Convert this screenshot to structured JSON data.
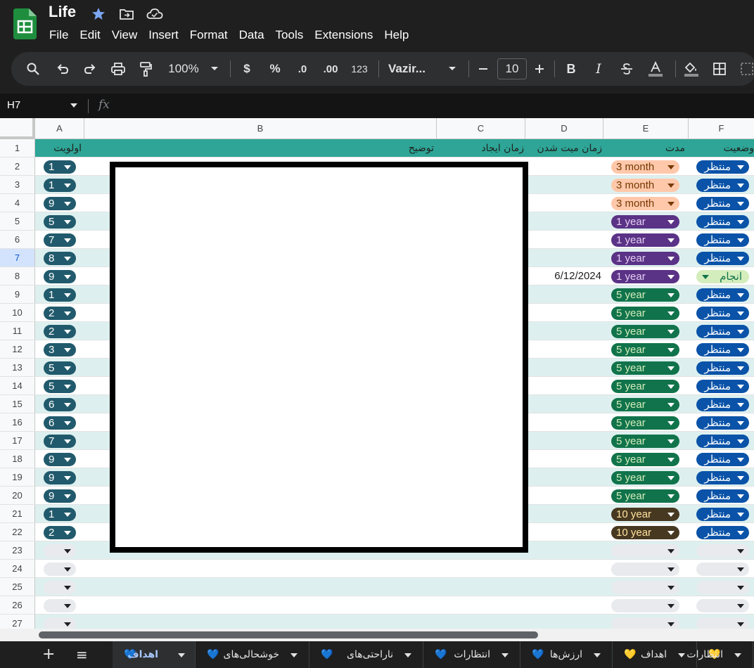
{
  "app": {
    "title": "Life"
  },
  "menu": [
    "File",
    "Edit",
    "View",
    "Insert",
    "Format",
    "Data",
    "Tools",
    "Extensions",
    "Help"
  ],
  "toolbar": {
    "zoom": "100%",
    "currency": "$",
    "percent": "%",
    "dec_less": ".0",
    "dec_more": ".00",
    "number_format": "123",
    "font": "Vazir...",
    "font_size": "10"
  },
  "formula": {
    "name_box": "H7",
    "fx": "fx"
  },
  "columns": [
    "A",
    "B",
    "C",
    "D",
    "E",
    "F"
  ],
  "header_row": {
    "number": "1",
    "A": "اولویت",
    "B": "توضیح",
    "C": "زمان ایجاد",
    "D": "زمان میت شدن",
    "E": "مدت",
    "F": "وضعیت"
  },
  "rows": [
    {
      "n": "2",
      "priority": "1",
      "duration": "3 month",
      "dtype": "m3",
      "status": "منتظر",
      "stype": "wait",
      "date": ""
    },
    {
      "n": "3",
      "priority": "1",
      "duration": "3 month",
      "dtype": "m3",
      "status": "منتظر",
      "stype": "wait",
      "date": ""
    },
    {
      "n": "4",
      "priority": "9",
      "duration": "3 month",
      "dtype": "m3",
      "status": "منتظر",
      "stype": "wait",
      "date": ""
    },
    {
      "n": "5",
      "priority": "5",
      "duration": "1 year",
      "dtype": "y1",
      "status": "منتظر",
      "stype": "wait",
      "date": ""
    },
    {
      "n": "6",
      "priority": "7",
      "duration": "1 year",
      "dtype": "y1",
      "status": "منتظر",
      "stype": "wait",
      "date": ""
    },
    {
      "n": "7",
      "priority": "8",
      "duration": "1 year",
      "dtype": "y1",
      "status": "منتظر",
      "stype": "wait",
      "date": ""
    },
    {
      "n": "8",
      "priority": "9",
      "duration": "1 year",
      "dtype": "y1",
      "status": "انجام",
      "stype": "done",
      "date": "6/12/2024"
    },
    {
      "n": "9",
      "priority": "1",
      "duration": "5 year",
      "dtype": "y5",
      "status": "منتظر",
      "stype": "wait",
      "date": ""
    },
    {
      "n": "10",
      "priority": "2",
      "duration": "5 year",
      "dtype": "y5",
      "status": "منتظر",
      "stype": "wait",
      "date": ""
    },
    {
      "n": "11",
      "priority": "2",
      "duration": "5 year",
      "dtype": "y5",
      "status": "منتظر",
      "stype": "wait",
      "date": ""
    },
    {
      "n": "12",
      "priority": "3",
      "duration": "5 year",
      "dtype": "y5",
      "status": "منتظر",
      "stype": "wait",
      "date": ""
    },
    {
      "n": "13",
      "priority": "5",
      "duration": "5 year",
      "dtype": "y5",
      "status": "منتظر",
      "stype": "wait",
      "date": ""
    },
    {
      "n": "14",
      "priority": "5",
      "duration": "5 year",
      "dtype": "y5",
      "status": "منتظر",
      "stype": "wait",
      "date": ""
    },
    {
      "n": "15",
      "priority": "6",
      "duration": "5 year",
      "dtype": "y5",
      "status": "منتظر",
      "stype": "wait",
      "date": ""
    },
    {
      "n": "16",
      "priority": "6",
      "duration": "5 year",
      "dtype": "y5",
      "status": "منتظر",
      "stype": "wait",
      "date": ""
    },
    {
      "n": "17",
      "priority": "7",
      "duration": "5 year",
      "dtype": "y5",
      "status": "منتظر",
      "stype": "wait",
      "date": ""
    },
    {
      "n": "18",
      "priority": "9",
      "duration": "5 year",
      "dtype": "y5",
      "status": "منتظر",
      "stype": "wait",
      "date": ""
    },
    {
      "n": "19",
      "priority": "9",
      "duration": "5 year",
      "dtype": "y5",
      "status": "منتظر",
      "stype": "wait",
      "date": ""
    },
    {
      "n": "20",
      "priority": "9",
      "duration": "5 year",
      "dtype": "y5",
      "status": "منتظر",
      "stype": "wait",
      "date": ""
    },
    {
      "n": "21",
      "priority": "1",
      "duration": "10 year",
      "dtype": "y10",
      "status": "منتظر",
      "stype": "wait",
      "date": ""
    },
    {
      "n": "22",
      "priority": "2",
      "duration": "10 year",
      "dtype": "y10",
      "status": "منتظر",
      "stype": "wait",
      "date": ""
    },
    {
      "n": "23",
      "priority": "",
      "duration": "",
      "dtype": "empty",
      "status": "",
      "stype": "empty",
      "date": ""
    },
    {
      "n": "24",
      "priority": "",
      "duration": "",
      "dtype": "empty",
      "status": "",
      "stype": "empty",
      "date": ""
    },
    {
      "n": "25",
      "priority": "",
      "duration": "",
      "dtype": "empty",
      "status": "",
      "stype": "empty",
      "date": ""
    },
    {
      "n": "26",
      "priority": "",
      "duration": "",
      "dtype": "empty",
      "status": "",
      "stype": "empty",
      "date": ""
    },
    {
      "n": "27",
      "priority": "",
      "duration": "",
      "dtype": "empty",
      "status": "",
      "stype": "empty",
      "date": ""
    }
  ],
  "selected_row": "7",
  "sheets": [
    {
      "label": "اهداف",
      "heart": "💙",
      "active": true
    },
    {
      "label": "خوشحالی‌های",
      "heart": "💙",
      "active": false
    },
    {
      "label": "ناراحتی‌های",
      "heart": "💙",
      "active": false
    },
    {
      "label": "انتظارات",
      "heart": "💙",
      "active": false
    },
    {
      "label": "ارزش‌ها",
      "heart": "💙",
      "active": false
    },
    {
      "label": "اهداف",
      "heart": "💛",
      "active": false
    },
    {
      "label": "انتظارات",
      "heart": "💛",
      "active": false
    }
  ],
  "colors": {
    "header_fill": "#2ea596",
    "alt_row": "#ddf0ef",
    "priority_chip": "#215a6c",
    "status_wait": "#0a53a8",
    "status_done": "#d4edbc"
  }
}
